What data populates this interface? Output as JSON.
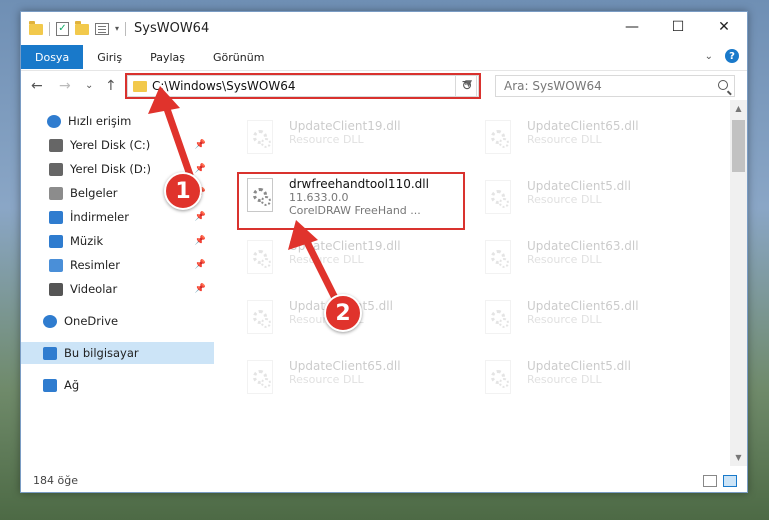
{
  "window": {
    "title": "SysWOW64",
    "controls": {
      "minimize": "—",
      "maximize": "☐",
      "close": "✕"
    }
  },
  "ribbon": {
    "tabs": [
      "Dosya",
      "Giriş",
      "Paylaş",
      "Görünüm"
    ],
    "help": "?"
  },
  "nav": {
    "back": "←",
    "forward": "→",
    "recent": "⌄",
    "up": "↑",
    "address": "C:\\Windows\\SysWOW64",
    "refresh": "↻",
    "search_placeholder": "Ara: SysWOW64"
  },
  "sidebar": {
    "items": [
      {
        "label": "Hızlı erişim",
        "icon": "star-icon",
        "pinned": false
      },
      {
        "label": "Yerel Disk (C:)",
        "icon": "drive-icon",
        "pinned": true
      },
      {
        "label": "Yerel Disk (D:)",
        "icon": "drive-icon",
        "pinned": true
      },
      {
        "label": "Belgeler",
        "icon": "documents-icon",
        "pinned": true
      },
      {
        "label": "İndirmeler",
        "icon": "download-icon",
        "pinned": true
      },
      {
        "label": "Müzik",
        "icon": "music-icon",
        "pinned": true
      },
      {
        "label": "Resimler",
        "icon": "pictures-icon",
        "pinned": true
      },
      {
        "label": "Videolar",
        "icon": "video-icon",
        "pinned": true
      },
      {
        "label": "OneDrive",
        "icon": "cloud-icon",
        "pinned": false
      },
      {
        "label": "Bu bilgisayar",
        "icon": "computer-icon",
        "pinned": false,
        "selected": true
      },
      {
        "label": "Ağ",
        "icon": "network-icon",
        "pinned": false
      }
    ]
  },
  "files": [
    {
      "name": "UpdateClient19.dll",
      "line2": "Resource DLL",
      "faded": true
    },
    {
      "name": "UpdateClient65.dll",
      "line2": "Resource DLL",
      "faded": true
    },
    {
      "name": "drwfreehandtool110.dll",
      "line2": "11.633.0.0",
      "line3": "CorelDRAW FreeHand ...",
      "faded": false,
      "highlighted": true
    },
    {
      "name": "UpdateClient5.dll",
      "line2": "Resource DLL",
      "faded": true
    },
    {
      "name": "UpdateClient19.dll",
      "line2": "Resource DLL",
      "faded": true
    },
    {
      "name": "UpdateClient63.dll",
      "line2": "Resource DLL",
      "faded": true
    },
    {
      "name": "UpdateClient5.dll",
      "line2": "Resource DLL",
      "faded": true
    },
    {
      "name": "UpdateClient65.dll",
      "line2": "Resource DLL",
      "faded": true
    },
    {
      "name": "UpdateClient65.dll",
      "line2": "Resource DLL",
      "faded": true
    },
    {
      "name": "UpdateClient5.dll",
      "line2": "Resource DLL",
      "faded": true
    }
  ],
  "status": {
    "item_count": "184 öğe"
  },
  "callouts": {
    "one": "1",
    "two": "2"
  },
  "colors": {
    "accent": "#1979ca",
    "highlight": "#d9322e",
    "callout": "#e0332c"
  }
}
